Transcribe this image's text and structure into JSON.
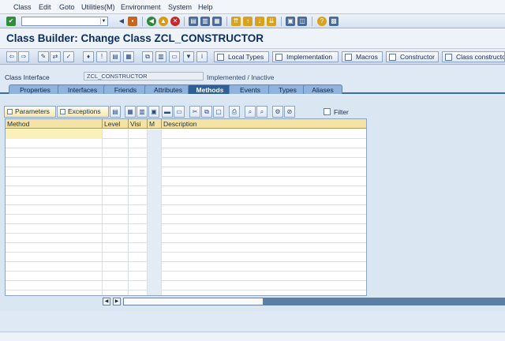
{
  "menu": [
    "Class",
    "Edit",
    "Goto",
    "Utilities(M)",
    "Environment",
    "System",
    "Help"
  ],
  "command_field": {
    "value": ""
  },
  "title": "Class Builder: Change Class ZCL_CONSTRUCTOR",
  "app_toolbar": {
    "buttons": [
      "Local Types",
      "Implementation",
      "Macros",
      "Constructor",
      "Class constructor"
    ]
  },
  "header": {
    "label": "Class Interface",
    "value": "ZCL_CONSTRUCTOR",
    "status": "Implemented / Inactive"
  },
  "tabs": [
    {
      "label": "Properties",
      "active": false
    },
    {
      "label": "Interfaces",
      "active": false
    },
    {
      "label": "Friends",
      "active": false
    },
    {
      "label": "Attributes",
      "active": false
    },
    {
      "label": "Methods",
      "active": true
    },
    {
      "label": "Events",
      "active": false
    },
    {
      "label": "Types",
      "active": false
    },
    {
      "label": "Aliases",
      "active": false
    }
  ],
  "grid_toolbar": {
    "parameters_label": "Parameters",
    "exceptions_label": "Exceptions",
    "filter_label": "Filter"
  },
  "methods_table": {
    "columns": [
      "Method",
      "Level",
      "Visi",
      "M",
      "Description"
    ],
    "rows": []
  },
  "colors": {
    "accent": "#2f5f96",
    "header_bg": "#f4e3a2",
    "tab_bg": "#8fb3dc"
  }
}
